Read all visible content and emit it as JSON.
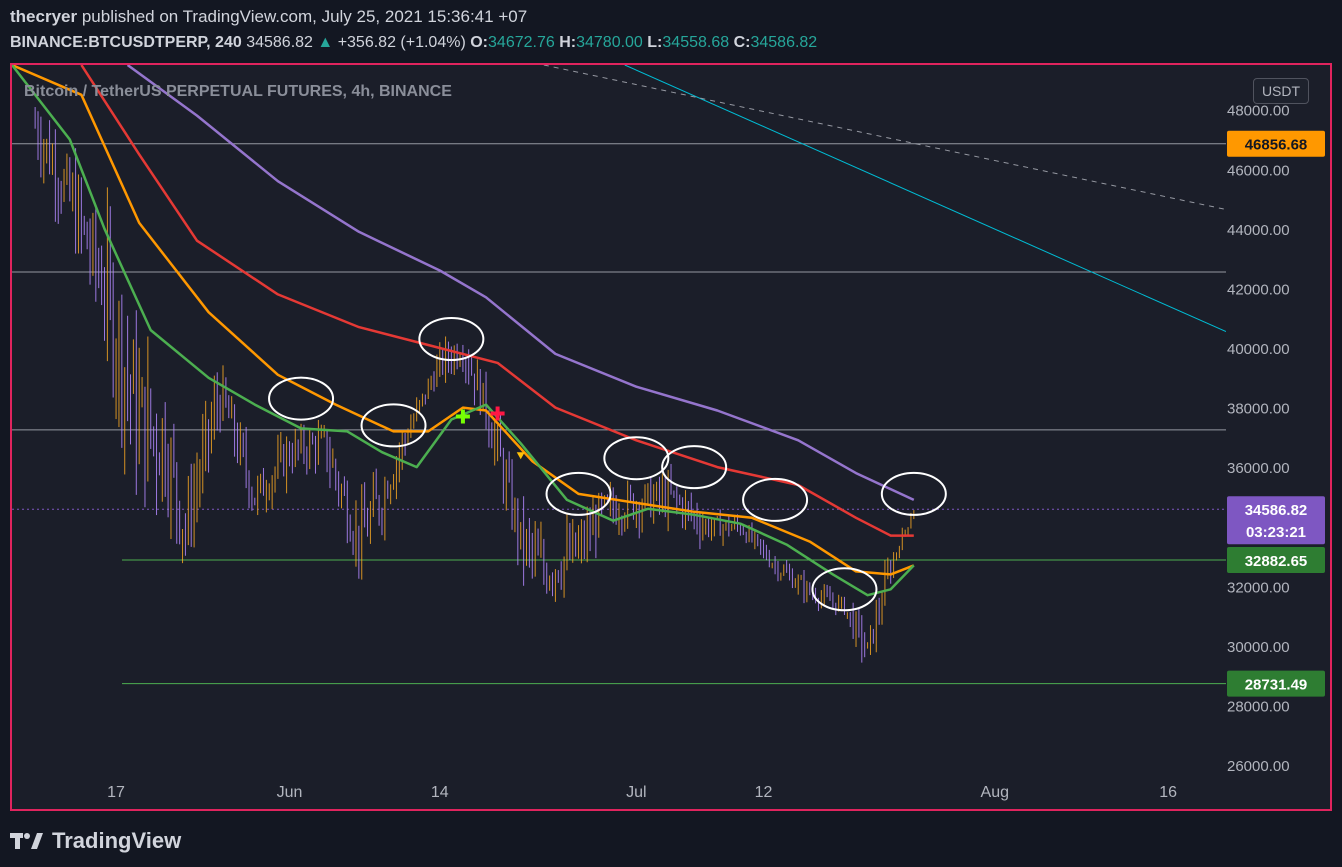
{
  "header": {
    "author": "thecryer",
    "published_text": "published on TradingView.com, July 25, 2021 15:36:41 +07",
    "symbol": "BINANCE:BTCUSDTPERP, 240",
    "last_price": "34586.82",
    "change_arrow": "▲",
    "change_text": "+356.82 (+1.04%)",
    "open_label": "O:",
    "open_value": "34672.76",
    "high_label": "H:",
    "high_value": "34780.00",
    "low_label": "L:",
    "low_value": "34558.68",
    "close_label": "C:",
    "close_value": "34586.82"
  },
  "footer": {
    "brand": "TradingView",
    "logo_icon": "tradingview-logo-icon"
  },
  "chart_data": {
    "type": "line",
    "title": "Bitcoin / TetherUS PERPETUAL FUTURES, 4h, BINANCE",
    "unit": "USDT",
    "ylim": [
      26000,
      49500
    ],
    "y_ticks": [
      26000,
      28000,
      30000,
      32000,
      34000,
      36000,
      38000,
      40000,
      42000,
      44000,
      46000,
      48000
    ],
    "x_labels": [
      {
        "label": "17",
        "date": "2021-05-17"
      },
      {
        "label": "Jun",
        "date": "2021-06-01"
      },
      {
        "label": "14",
        "date": "2021-06-14"
      },
      {
        "label": "Jul",
        "date": "2021-07-01"
      },
      {
        "label": "12",
        "date": "2021-07-12"
      },
      {
        "label": "Aug",
        "date": "2021-08-01"
      },
      {
        "label": "16",
        "date": "2021-08-16"
      }
    ],
    "x_range": [
      "2021-05-08",
      "2021-08-21"
    ],
    "grid": false,
    "price_tags": [
      {
        "value": "46856.68",
        "price": 46856.68,
        "color": "#ff9800",
        "text_color": "#131722"
      },
      {
        "value": "34586.82",
        "sub": "03:23:21",
        "price": 34586.82,
        "color": "#7e57c2",
        "text_color": "#ffffff"
      },
      {
        "value": "32882.65",
        "price": 32882.65,
        "color": "#2e7d32",
        "text_color": "#ffffff"
      },
      {
        "value": "28731.49",
        "price": 28731.49,
        "color": "#2e7d32",
        "text_color": "#ffffff"
      }
    ],
    "horizontal_levels": [
      {
        "price": 46856.68,
        "color": "#9598a1"
      },
      {
        "price": 42550,
        "color": "#9598a1"
      },
      {
        "price": 37250,
        "color": "#9598a1"
      },
      {
        "price": 32882.65,
        "color": "#4caf50"
      },
      {
        "price": 28731.49,
        "color": "#4caf50"
      }
    ],
    "series": [
      {
        "key": "ma200",
        "color": "#9575cd",
        "points": [
          [
            "2021-05-18",
            49500
          ],
          [
            "2021-05-24",
            47800
          ],
          [
            "2021-05-31",
            45600
          ],
          [
            "2021-06-07",
            43900
          ],
          [
            "2021-06-14",
            42600
          ],
          [
            "2021-06-18",
            41700
          ],
          [
            "2021-06-24",
            39800
          ],
          [
            "2021-07-01",
            38700
          ],
          [
            "2021-07-08",
            37900
          ],
          [
            "2021-07-15",
            36900
          ],
          [
            "2021-07-20",
            35800
          ],
          [
            "2021-07-25",
            34900
          ]
        ]
      },
      {
        "key": "ma100",
        "color": "#e53935",
        "points": [
          [
            "2021-05-14",
            49500
          ],
          [
            "2021-05-19",
            46500
          ],
          [
            "2021-05-24",
            43600
          ],
          [
            "2021-05-31",
            41800
          ],
          [
            "2021-06-07",
            40700
          ],
          [
            "2021-06-14",
            40000
          ],
          [
            "2021-06-19",
            39500
          ],
          [
            "2021-06-24",
            38000
          ],
          [
            "2021-07-01",
            36900
          ],
          [
            "2021-07-08",
            36000
          ],
          [
            "2021-07-15",
            35400
          ],
          [
            "2021-07-20",
            34300
          ],
          [
            "2021-07-23",
            33700
          ],
          [
            "2021-07-25",
            33700
          ]
        ]
      },
      {
        "key": "ma50",
        "color": "#ff9800",
        "points": [
          [
            "2021-05-08",
            49500
          ],
          [
            "2021-05-14",
            48500
          ],
          [
            "2021-05-19",
            44200
          ],
          [
            "2021-05-25",
            41200
          ],
          [
            "2021-05-31",
            39100
          ],
          [
            "2021-06-05",
            38100
          ],
          [
            "2021-06-10",
            37200
          ],
          [
            "2021-06-13",
            37200
          ],
          [
            "2021-06-16",
            38000
          ],
          [
            "2021-06-18",
            37900
          ],
          [
            "2021-06-22",
            36200
          ],
          [
            "2021-06-26",
            35100
          ],
          [
            "2021-07-01",
            34800
          ],
          [
            "2021-07-06",
            34500
          ],
          [
            "2021-07-11",
            34300
          ],
          [
            "2021-07-16",
            33500
          ],
          [
            "2021-07-20",
            32500
          ],
          [
            "2021-07-23",
            32400
          ],
          [
            "2021-07-25",
            32700
          ]
        ]
      },
      {
        "key": "ma20",
        "color": "#4caf50",
        "points": [
          [
            "2021-05-08",
            49500
          ],
          [
            "2021-05-13",
            47000
          ],
          [
            "2021-05-16",
            44000
          ],
          [
            "2021-05-20",
            40600
          ],
          [
            "2021-05-25",
            39000
          ],
          [
            "2021-05-29",
            38100
          ],
          [
            "2021-06-02",
            37300
          ],
          [
            "2021-06-06",
            37200
          ],
          [
            "2021-06-09",
            36500
          ],
          [
            "2021-06-12",
            36000
          ],
          [
            "2021-06-15",
            37600
          ],
          [
            "2021-06-18",
            38100
          ],
          [
            "2021-06-21",
            36800
          ],
          [
            "2021-06-25",
            34900
          ],
          [
            "2021-06-29",
            34200
          ],
          [
            "2021-07-02",
            34600
          ],
          [
            "2021-07-06",
            34400
          ],
          [
            "2021-07-10",
            34100
          ],
          [
            "2021-07-14",
            33400
          ],
          [
            "2021-07-18",
            32400
          ],
          [
            "2021-07-21",
            31700
          ],
          [
            "2021-07-23",
            31900
          ],
          [
            "2021-07-25",
            32700
          ]
        ]
      }
    ],
    "trendlines": [
      {
        "from": [
          "2021-06-30",
          49500
        ],
        "to": [
          "2021-08-21",
          40550
        ],
        "color": "#00bcd4",
        "dashed": false
      },
      {
        "from": [
          "2021-06-23",
          49500
        ],
        "to": [
          "2021-08-21",
          44650
        ],
        "color": "#9598a1",
        "dashed": true
      }
    ],
    "annotations": [
      {
        "type": "circle",
        "at": [
          "2021-06-02",
          38300
        ],
        "color": "#ffffff"
      },
      {
        "type": "circle",
        "at": [
          "2021-06-10",
          37400
        ],
        "color": "#ffffff"
      },
      {
        "type": "circle",
        "at": [
          "2021-06-15",
          40300
        ],
        "color": "#ffffff"
      },
      {
        "type": "circle",
        "at": [
          "2021-06-26",
          35100
        ],
        "color": "#ffffff"
      },
      {
        "type": "circle",
        "at": [
          "2021-07-01",
          36300
        ],
        "color": "#ffffff"
      },
      {
        "type": "circle",
        "at": [
          "2021-07-06",
          36000
        ],
        "color": "#ffffff"
      },
      {
        "type": "circle",
        "at": [
          "2021-07-13",
          34900
        ],
        "color": "#ffffff"
      },
      {
        "type": "circle",
        "at": [
          "2021-07-19",
          31900
        ],
        "color": "#ffffff"
      },
      {
        "type": "circle",
        "at": [
          "2021-07-25",
          35100
        ],
        "color": "#ffffff"
      },
      {
        "type": "cross",
        "at": [
          "2021-06-16",
          37700
        ],
        "color": "#76ff03"
      },
      {
        "type": "cross",
        "at": [
          "2021-06-19",
          37800
        ],
        "color": "#ff1744"
      },
      {
        "type": "triangle-down",
        "at": [
          "2021-06-21",
          36400
        ],
        "color": "#ffc107"
      }
    ],
    "candles_summary": [
      [
        "2021-05-10",
        47500,
        49500,
        45500
      ],
      [
        "2021-05-13",
        45000,
        49000,
        43000
      ],
      [
        "2021-05-16",
        42000,
        46500,
        39000
      ],
      [
        "2021-05-19",
        37500,
        43500,
        30000
      ],
      [
        "2021-05-21",
        37000,
        40500,
        33000
      ],
      [
        "2021-05-23",
        34000,
        38500,
        31500
      ],
      [
        "2021-05-26",
        38500,
        40000,
        36500
      ],
      [
        "2021-05-29",
        35000,
        38500,
        34200
      ],
      [
        "2021-06-01",
        36500,
        37900,
        35700
      ],
      [
        "2021-06-04",
        36800,
        39300,
        35600
      ],
      [
        "2021-06-07",
        33500,
        36600,
        31800
      ],
      [
        "2021-06-09",
        35000,
        37500,
        32400
      ],
      [
        "2021-06-11",
        37000,
        37700,
        35800
      ],
      [
        "2021-06-14",
        39500,
        40800,
        38500
      ],
      [
        "2021-06-16",
        40000,
        41000,
        38000
      ],
      [
        "2021-06-18",
        38000,
        39000,
        35500
      ],
      [
        "2021-06-21",
        33500,
        36000,
        31200
      ],
      [
        "2021-06-23",
        32500,
        34000,
        28800
      ],
      [
        "2021-06-26",
        33200,
        35500,
        31500
      ],
      [
        "2021-06-28",
        34500,
        36600,
        33500
      ],
      [
        "2021-07-01",
        34800,
        36000,
        32700
      ],
      [
        "2021-07-04",
        35000,
        36500,
        33300
      ],
      [
        "2021-07-07",
        34000,
        35100,
        32800
      ],
      [
        "2021-07-10",
        34000,
        34400,
        33200
      ],
      [
        "2021-07-13",
        32700,
        33600,
        31800
      ],
      [
        "2021-07-16",
        31800,
        32700,
        31300
      ],
      [
        "2021-07-19",
        31300,
        32000,
        30500
      ],
      [
        "2021-07-21",
        29800,
        32800,
        29300
      ],
      [
        "2021-07-23",
        32700,
        33600,
        31900
      ],
      [
        "2021-07-25",
        34586.82,
        34780,
        34400
      ]
    ]
  }
}
